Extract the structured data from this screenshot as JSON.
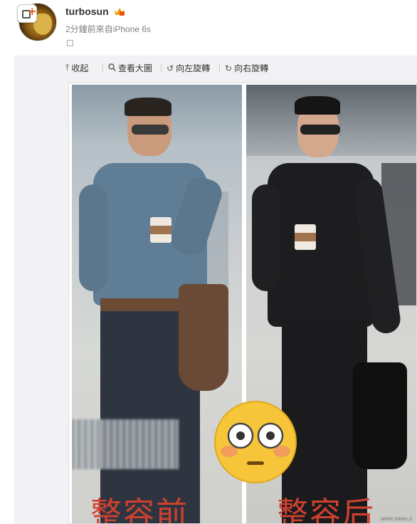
{
  "post": {
    "username": "turbosun",
    "meta": "2分鐘前來自iPhone 6s"
  },
  "toolbar": {
    "collapse_label": "收起",
    "view_large_label": "查看大圖",
    "rotate_left_label": "向左旋轉",
    "rotate_right_label": "向右旋轉"
  },
  "image": {
    "caption_left": "整容前",
    "caption_right": "整容后",
    "watermark": "www.news.s"
  },
  "icons": {
    "avatar_badge": "add-post-icon",
    "vip": "vip-badge-icon",
    "collapse": "arrow-up-icon",
    "view_large": "magnifier-icon",
    "rotate_left": "rotate-left-icon",
    "rotate_right": "rotate-right-icon",
    "emoji": "flushed-face-icon"
  },
  "colors": {
    "caption": "#d0402e",
    "username": "#333333",
    "meta": "#808080",
    "viewer_bg": "#f2f2f5"
  }
}
